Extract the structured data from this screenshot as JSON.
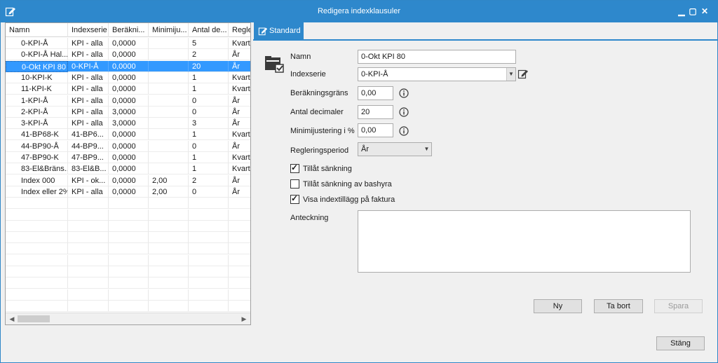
{
  "window": {
    "title": "Redigera indexklausuler",
    "min_glyph": "▁",
    "max_glyph": "▢",
    "close_glyph": "✕"
  },
  "grid": {
    "columns": [
      "Namn",
      "Indexserie",
      "Beräkni...",
      "Minimiju...",
      "Antal de...",
      "Regle"
    ],
    "rows": [
      [
        "0-KPI-Å",
        "KPI - alla",
        "0,0000",
        "",
        "5",
        "Kvart"
      ],
      [
        "0-KPI-Å Hal...",
        "KPI - alla",
        "0,0000",
        "",
        "2",
        "År"
      ],
      [
        "0-Okt KPI 80",
        "0-KPI-Å",
        "0,0000",
        "",
        "20",
        "År"
      ],
      [
        "10-KPI-K",
        "KPI - alla",
        "0,0000",
        "",
        "1",
        "Kvart"
      ],
      [
        "11-KPI-K",
        "KPI - alla",
        "0,0000",
        "",
        "1",
        "Kvart"
      ],
      [
        "1-KPI-Å",
        "KPI - alla",
        "0,0000",
        "",
        "0",
        "År"
      ],
      [
        "2-KPI-Å",
        "KPI - alla",
        "3,0000",
        "",
        "0",
        "År"
      ],
      [
        "3-KPI-Å",
        "KPI - alla",
        "3,0000",
        "",
        "3",
        "År"
      ],
      [
        "41-BP68-K",
        "41-BP6...",
        "0,0000",
        "",
        "1",
        "Kvart"
      ],
      [
        "44-BP90-Å",
        "44-BP9...",
        "0,0000",
        "",
        "0",
        "År"
      ],
      [
        "47-BP90-K",
        "47-BP9...",
        "0,0000",
        "",
        "1",
        "Kvart"
      ],
      [
        "83-El&Bräns...",
        "83-El&B...",
        "0,0000",
        "",
        "1",
        "Kvart"
      ],
      [
        "Index 000",
        "KPI - ok...",
        "0,0000",
        "2,00",
        "2",
        "År"
      ],
      [
        "Index eller 2%",
        "KPI - alla",
        "0,0000",
        "2,00",
        "0",
        "År"
      ]
    ],
    "selected_row": 2
  },
  "tab": {
    "label": "Standard"
  },
  "form": {
    "namn_label": "Namn",
    "namn_value": "0-Okt KPI 80",
    "indexserie_label": "Indexserie",
    "indexserie_value": "0-KPI-Å",
    "berakningsgrans_label": "Beräkningsgräns",
    "berakningsgrans_value": "0,00",
    "antal_decimaler_label": "Antal decimaler",
    "antal_decimaler_value": "20",
    "minimijustering_label": "Minimijustering i %",
    "minimijustering_value": "0,00",
    "regleringsperiod_label": "Regleringsperiod",
    "regleringsperiod_value": "År",
    "tillat_sankning_label": "Tillåt sänkning",
    "tillat_sankning_checked": true,
    "tillat_sankning_bashyra_label": "Tillåt sänkning av bashyra",
    "tillat_sankning_bashyra_checked": false,
    "visa_indextillagg_label": "Visa indextillägg på faktura",
    "visa_indextillagg_checked": true,
    "anteckning_label": "Anteckning",
    "anteckning_value": ""
  },
  "buttons": {
    "ny": "Ny",
    "ta_bort": "Ta bort",
    "spara": "Spara",
    "stang": "Stäng"
  },
  "colors": {
    "accent": "#2e88cc",
    "selection": "#3399ff"
  }
}
